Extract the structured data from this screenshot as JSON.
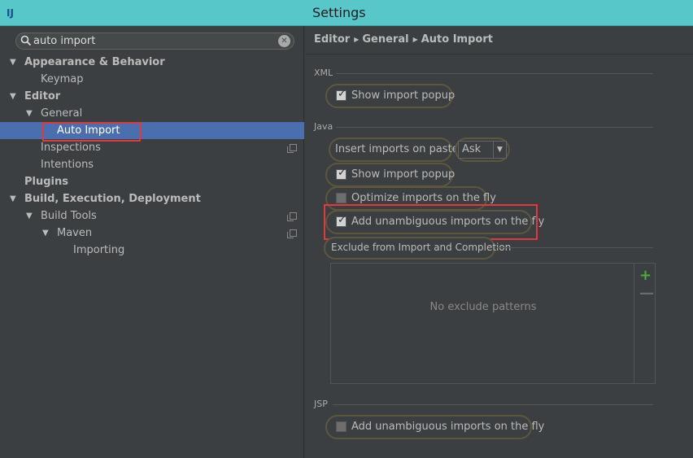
{
  "window": {
    "title": "Settings",
    "logo": "IJ"
  },
  "search": {
    "query": "auto import"
  },
  "tree": [
    {
      "label": "Appearance & Behavior",
      "level": 0,
      "expanded": true,
      "bold": true
    },
    {
      "label": "Keymap",
      "level": 1
    },
    {
      "label": "Editor",
      "level": 0,
      "expanded": true,
      "bold": true
    },
    {
      "label": "General",
      "level": 1,
      "expanded": true
    },
    {
      "label": "Auto Import",
      "level": 2,
      "selected": true
    },
    {
      "label": "Inspections",
      "level": 1,
      "copy": true
    },
    {
      "label": "Intentions",
      "level": 1
    },
    {
      "label": "Plugins",
      "level": 0,
      "bold": true
    },
    {
      "label": "Build, Execution, Deployment",
      "level": 0,
      "expanded": true,
      "bold": true
    },
    {
      "label": "Build Tools",
      "level": 1,
      "expanded": true,
      "copy": true
    },
    {
      "label": "Maven",
      "level": 2,
      "expanded": true,
      "copy": true
    },
    {
      "label": "Importing",
      "level": 3
    }
  ],
  "breadcrumb": [
    "Editor",
    "General",
    "Auto Import"
  ],
  "xml": {
    "section": "XML",
    "show_import_popup": {
      "label": "Show import popup",
      "checked": true
    }
  },
  "java": {
    "section": "Java",
    "insert_on_paste_label": "Insert imports on paste:",
    "insert_on_paste_value": "Ask",
    "show_import_popup": {
      "label": "Show import popup",
      "checked": true
    },
    "optimize_imports": {
      "label": "Optimize imports on the fly",
      "checked": false
    },
    "add_unambiguous": {
      "label": "Add unambiguous imports on the fly",
      "checked": true
    },
    "exclude_label": "Exclude from Import and Completion",
    "exclude_empty": "No exclude patterns"
  },
  "jsp": {
    "section": "JSP",
    "add_unambiguous": {
      "label": "Add unambiguous imports on the fly",
      "checked": false
    }
  },
  "colors": {
    "highlight": "#e03a3e",
    "selection": "#4b6eaf",
    "titlebar": "#57c7c9"
  }
}
